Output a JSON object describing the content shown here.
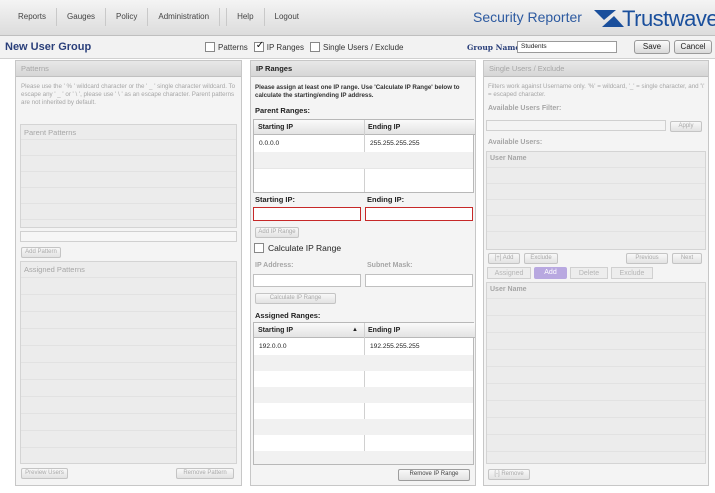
{
  "nav": {
    "items": [
      "Reports",
      "Gauges",
      "Policy",
      "Administration",
      "Help",
      "Logout"
    ]
  },
  "app_title": "Security Reporter",
  "brand": {
    "word": "Trustwave",
    "suffix": "®",
    "color": "#1a4f9c"
  },
  "titlebar": {
    "page_title": "New User Group",
    "checkboxes": [
      {
        "label": "Patterns",
        "checked": false
      },
      {
        "label": "IP Ranges",
        "checked": true
      },
      {
        "label": "Single Users / Exclude",
        "checked": false
      }
    ],
    "group_name_label": "Group Name:",
    "group_name_value": "Students",
    "save_label": "Save",
    "cancel_label": "Cancel"
  },
  "patterns": {
    "header": "Patterns",
    "note": "Please use the ' % ' wildcard character or the ' _ ' single character wildcard. To escape any ' _ ' or ' \\ ', please use ' \\ ' as an escape character. Parent patterns are not inherited by default.",
    "parent_title": "Parent Patterns",
    "add_button": "Add Pattern",
    "assigned_title": "Assigned Patterns",
    "preview_button": "Preview Users",
    "remove_button": "Remove Pattern"
  },
  "ip_ranges": {
    "header": "IP Ranges",
    "note": "Please assign at least one IP range. Use 'Calculate IP Range' below to calculate the starting/ending IP address.",
    "parent_title": "Parent Ranges:",
    "parent_table": {
      "columns": [
        "Starting IP",
        "Ending IP"
      ],
      "rows": [
        [
          "0.0.0.0",
          "255.255.255.255"
        ]
      ]
    },
    "starting_label": "Starting IP:",
    "ending_label": "Ending IP:",
    "add_button": "Add IP Range",
    "calc_label": "Calculate IP Range",
    "ip_address_label": "IP Address:",
    "subnet_label": "Subnet Mask:",
    "calc_button": "Calculate IP Range",
    "assigned_title": "Assigned Ranges:",
    "assigned_table": {
      "columns": [
        "Starting IP",
        "Ending IP"
      ],
      "sort_icon": "▲",
      "rows": [
        [
          "192.0.0.0",
          "192.255.255.255"
        ]
      ]
    },
    "remove_button": "Remove IP Range"
  },
  "single_users": {
    "header": "Single Users / Exclude",
    "note": "Filters work against Username only. '%' = wildcard, '_' = single character, and '\\' = escaped character.",
    "filter_label": "Available Users Filter:",
    "apply_button": "Apply",
    "available_label": "Available Users:",
    "user_col": "User Name",
    "add_btn": "[+] Add",
    "exclude_btn": "Exclude",
    "previous_btn": "Previous",
    "next_btn": "Next",
    "tabs": [
      "Assigned",
      "Add",
      "Delete",
      "Exclude"
    ],
    "active_tab_color": "#b8a8e0",
    "assigned_user_col": "User Name",
    "remove_btn": "[-] Remove"
  }
}
